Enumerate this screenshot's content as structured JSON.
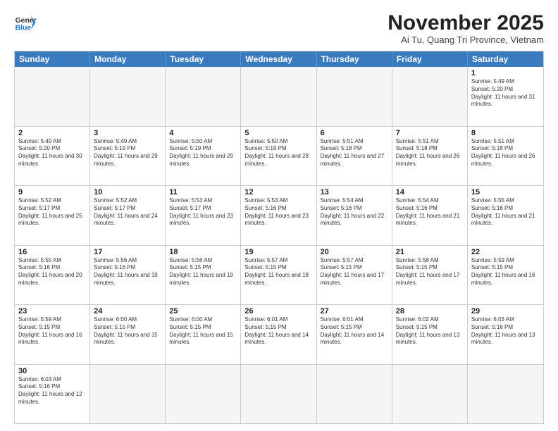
{
  "header": {
    "logo_general": "General",
    "logo_blue": "Blue",
    "month_title": "November 2025",
    "subtitle": "Ai Tu, Quang Tri Province, Vietnam"
  },
  "days_of_week": [
    "Sunday",
    "Monday",
    "Tuesday",
    "Wednesday",
    "Thursday",
    "Friday",
    "Saturday"
  ],
  "rows": [
    [
      {
        "day": "",
        "empty": true
      },
      {
        "day": "",
        "empty": true
      },
      {
        "day": "",
        "empty": true
      },
      {
        "day": "",
        "empty": true
      },
      {
        "day": "",
        "empty": true
      },
      {
        "day": "",
        "empty": true
      },
      {
        "day": "1",
        "sunrise": "Sunrise: 5:49 AM",
        "sunset": "Sunset: 5:20 PM",
        "daylight": "Daylight: 11 hours and 31 minutes."
      }
    ],
    [
      {
        "day": "2",
        "sunrise": "Sunrise: 5:49 AM",
        "sunset": "Sunset: 5:20 PM",
        "daylight": "Daylight: 11 hours and 30 minutes."
      },
      {
        "day": "3",
        "sunrise": "Sunrise: 5:49 AM",
        "sunset": "Sunset: 5:19 PM",
        "daylight": "Daylight: 11 hours and 29 minutes."
      },
      {
        "day": "4",
        "sunrise": "Sunrise: 5:50 AM",
        "sunset": "Sunset: 5:19 PM",
        "daylight": "Daylight: 11 hours and 29 minutes."
      },
      {
        "day": "5",
        "sunrise": "Sunrise: 5:50 AM",
        "sunset": "Sunset: 5:19 PM",
        "daylight": "Daylight: 11 hours and 28 minutes."
      },
      {
        "day": "6",
        "sunrise": "Sunrise: 5:51 AM",
        "sunset": "Sunset: 5:18 PM",
        "daylight": "Daylight: 11 hours and 27 minutes."
      },
      {
        "day": "7",
        "sunrise": "Sunrise: 5:51 AM",
        "sunset": "Sunset: 5:18 PM",
        "daylight": "Daylight: 11 hours and 26 minutes."
      },
      {
        "day": "8",
        "sunrise": "Sunrise: 5:51 AM",
        "sunset": "Sunset: 5:18 PM",
        "daylight": "Daylight: 11 hours and 26 minutes."
      }
    ],
    [
      {
        "day": "9",
        "sunrise": "Sunrise: 5:52 AM",
        "sunset": "Sunset: 5:17 PM",
        "daylight": "Daylight: 11 hours and 25 minutes."
      },
      {
        "day": "10",
        "sunrise": "Sunrise: 5:52 AM",
        "sunset": "Sunset: 5:17 PM",
        "daylight": "Daylight: 11 hours and 24 minutes."
      },
      {
        "day": "11",
        "sunrise": "Sunrise: 5:53 AM",
        "sunset": "Sunset: 5:17 PM",
        "daylight": "Daylight: 11 hours and 23 minutes."
      },
      {
        "day": "12",
        "sunrise": "Sunrise: 5:53 AM",
        "sunset": "Sunset: 5:16 PM",
        "daylight": "Daylight: 11 hours and 23 minutes."
      },
      {
        "day": "13",
        "sunrise": "Sunrise: 5:54 AM",
        "sunset": "Sunset: 5:16 PM",
        "daylight": "Daylight: 11 hours and 22 minutes."
      },
      {
        "day": "14",
        "sunrise": "Sunrise: 5:54 AM",
        "sunset": "Sunset: 5:16 PM",
        "daylight": "Daylight: 11 hours and 21 minutes."
      },
      {
        "day": "15",
        "sunrise": "Sunrise: 5:55 AM",
        "sunset": "Sunset: 5:16 PM",
        "daylight": "Daylight: 11 hours and 21 minutes."
      }
    ],
    [
      {
        "day": "16",
        "sunrise": "Sunrise: 5:55 AM",
        "sunset": "Sunset: 5:16 PM",
        "daylight": "Daylight: 11 hours and 20 minutes."
      },
      {
        "day": "17",
        "sunrise": "Sunrise: 5:56 AM",
        "sunset": "Sunset: 5:16 PM",
        "daylight": "Daylight: 11 hours and 19 minutes."
      },
      {
        "day": "18",
        "sunrise": "Sunrise: 5:56 AM",
        "sunset": "Sunset: 5:15 PM",
        "daylight": "Daylight: 11 hours and 19 minutes."
      },
      {
        "day": "19",
        "sunrise": "Sunrise: 5:57 AM",
        "sunset": "Sunset: 5:15 PM",
        "daylight": "Daylight: 11 hours and 18 minutes."
      },
      {
        "day": "20",
        "sunrise": "Sunrise: 5:57 AM",
        "sunset": "Sunset: 5:15 PM",
        "daylight": "Daylight: 11 hours and 17 minutes."
      },
      {
        "day": "21",
        "sunrise": "Sunrise: 5:58 AM",
        "sunset": "Sunset: 5:15 PM",
        "daylight": "Daylight: 11 hours and 17 minutes."
      },
      {
        "day": "22",
        "sunrise": "Sunrise: 5:59 AM",
        "sunset": "Sunset: 5:15 PM",
        "daylight": "Daylight: 11 hours and 16 minutes."
      }
    ],
    [
      {
        "day": "23",
        "sunrise": "Sunrise: 5:59 AM",
        "sunset": "Sunset: 5:15 PM",
        "daylight": "Daylight: 11 hours and 16 minutes."
      },
      {
        "day": "24",
        "sunrise": "Sunrise: 6:00 AM",
        "sunset": "Sunset: 5:15 PM",
        "daylight": "Daylight: 11 hours and 15 minutes."
      },
      {
        "day": "25",
        "sunrise": "Sunrise: 6:00 AM",
        "sunset": "Sunset: 5:15 PM",
        "daylight": "Daylight: 11 hours and 15 minutes."
      },
      {
        "day": "26",
        "sunrise": "Sunrise: 6:01 AM",
        "sunset": "Sunset: 5:15 PM",
        "daylight": "Daylight: 11 hours and 14 minutes."
      },
      {
        "day": "27",
        "sunrise": "Sunrise: 6:01 AM",
        "sunset": "Sunset: 5:15 PM",
        "daylight": "Daylight: 11 hours and 14 minutes."
      },
      {
        "day": "28",
        "sunrise": "Sunrise: 6:02 AM",
        "sunset": "Sunset: 5:15 PM",
        "daylight": "Daylight: 11 hours and 13 minutes."
      },
      {
        "day": "29",
        "sunrise": "Sunrise: 6:03 AM",
        "sunset": "Sunset: 5:16 PM",
        "daylight": "Daylight: 11 hours and 13 minutes."
      }
    ],
    [
      {
        "day": "30",
        "sunrise": "Sunrise: 6:03 AM",
        "sunset": "Sunset: 5:16 PM",
        "daylight": "Daylight: 11 hours and 12 minutes."
      },
      {
        "day": "",
        "empty": true
      },
      {
        "day": "",
        "empty": true
      },
      {
        "day": "",
        "empty": true
      },
      {
        "day": "",
        "empty": true
      },
      {
        "day": "",
        "empty": true
      },
      {
        "day": "",
        "empty": true
      }
    ]
  ]
}
